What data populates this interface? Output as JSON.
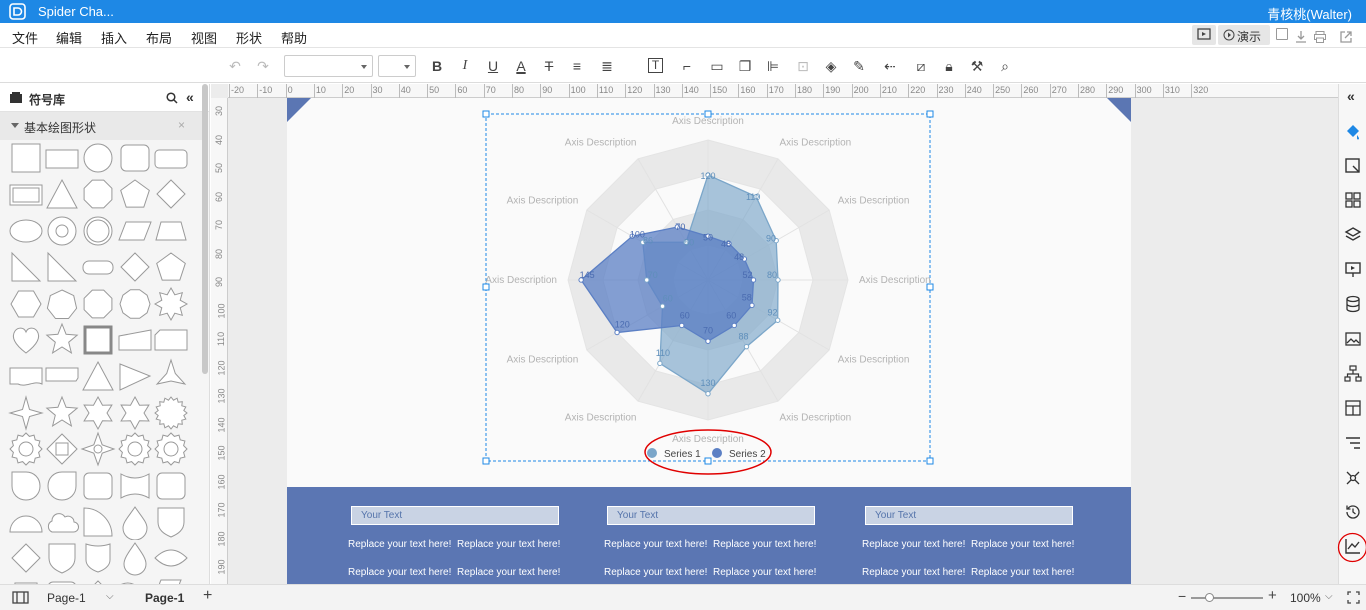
{
  "titlebar": {
    "title": "Spider Cha...",
    "user": "青核桃(Walter)"
  },
  "menu": {
    "items": [
      "文件",
      "编辑",
      "插入",
      "布局",
      "视图",
      "形状",
      "帮助"
    ],
    "present_label": "演示"
  },
  "library": {
    "title": "符号库",
    "category": "基本绘图形状"
  },
  "ruler": {
    "h": [
      "-20",
      "-10",
      "0",
      "10",
      "20",
      "30",
      "40",
      "50",
      "60",
      "70",
      "80",
      "90",
      "100",
      "110",
      "120",
      "130",
      "140",
      "150",
      "160",
      "170",
      "180",
      "190",
      "200",
      "210",
      "220",
      "230",
      "240",
      "250",
      "260",
      "270",
      "280",
      "290",
      "300",
      "310",
      "320"
    ],
    "v": [
      "30",
      "40",
      "50",
      "60",
      "70",
      "80",
      "90",
      "100",
      "110",
      "120",
      "130",
      "140",
      "150",
      "160",
      "170",
      "180",
      "190"
    ]
  },
  "chart_data": {
    "type": "radar",
    "axes": [
      "Axis Description",
      "Axis Description",
      "Axis Description",
      "Axis Description",
      "Axis Description",
      "Axis Description",
      "Axis Description",
      "Axis Description",
      "Axis Description",
      "Axis Description",
      "Axis Description",
      "Axis Description"
    ],
    "series": [
      {
        "name": "Series 1",
        "values": [
          120,
          110,
          90,
          80,
          92,
          88,
          130,
          110,
          60,
          70,
          86,
          50
        ],
        "color": "#7ba6c9"
      },
      {
        "name": "Series 2",
        "values": [
          50,
          48,
          48,
          52,
          58,
          60,
          70,
          60,
          120,
          145,
          100,
          70
        ],
        "color": "#5b7fc4"
      }
    ],
    "max": 160,
    "rings": 4,
    "legend": "bottom"
  },
  "infobox": {
    "columns": [
      {
        "title": "Your Text",
        "rows": [
          [
            "Replace your text here!",
            "Replace your text here!"
          ],
          [
            "Replace your text here!",
            "Replace your text here!"
          ]
        ]
      },
      {
        "title": "Your Text",
        "rows": [
          [
            "Replace your text here!",
            "Replace your text here!"
          ],
          [
            "Replace your text here!",
            "Replace your text here!"
          ]
        ]
      },
      {
        "title": "Your Text",
        "rows": [
          [
            "Replace your text here!",
            "Replace your text here!"
          ],
          [
            "Replace your text here!",
            "Replace your text here!"
          ]
        ]
      }
    ]
  },
  "statusbar": {
    "page_tab": "Page-1",
    "page_tab_active": "Page-1",
    "zoom": "100%"
  },
  "colors": {
    "accent": "#1e88e5",
    "blue_band": "#5b76b3",
    "highlight": "#e00000"
  }
}
